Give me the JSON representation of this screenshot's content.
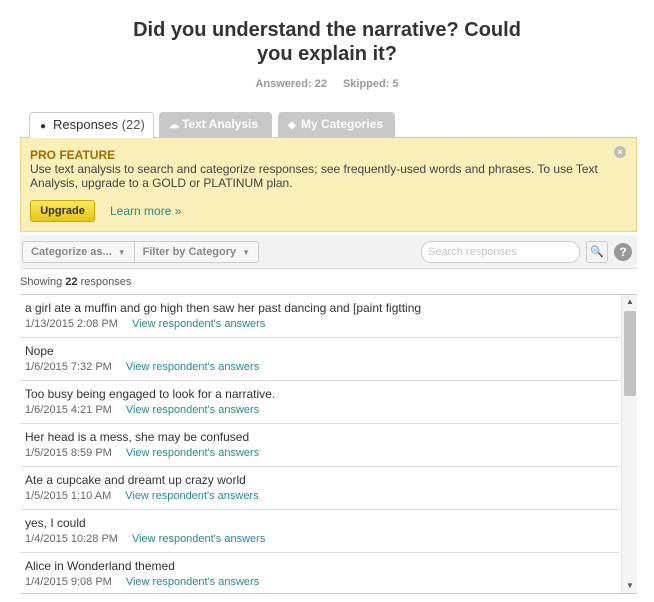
{
  "question": {
    "title_line1": "Did you understand the narrative? Could",
    "title_line2": "you explain it?"
  },
  "stats": {
    "answered": "Answered: 22",
    "skipped": "Skipped: 5"
  },
  "tabs": [
    {
      "label": "Responses",
      "count": "(22)",
      "icon": "speech-bubble-icon",
      "active": true
    },
    {
      "label": "Text Analysis",
      "icon": "cloud-icon",
      "active": false
    },
    {
      "label": "My Categories",
      "icon": "tag-icon",
      "active": false
    }
  ],
  "pro_feature": {
    "title": "PRO FEATURE",
    "text": "Use text analysis to search and categorize responses; see frequently-used words and phrases. To use Text Analysis, upgrade to a GOLD or PLATINUM plan.",
    "upgrade_label": "Upgrade",
    "learn_more_label": "Learn more »"
  },
  "toolbar": {
    "categorize_label": "Categorize as...",
    "filter_label": "Filter by Category",
    "search_placeholder": "Search responses",
    "search_icon": "🔍",
    "help_icon": "?"
  },
  "showing": {
    "prefix": "Showing",
    "count": "22",
    "suffix": "responses"
  },
  "responses": [
    {
      "text": "a girl ate a muffin and go high then saw her past dancing and [paint figtting",
      "timestamp": "1/13/2015 2:08 PM",
      "link": "View respondent's answers"
    },
    {
      "text": "Nope",
      "timestamp": "1/6/2015 7:32 PM",
      "link": "View respondent's answers"
    },
    {
      "text": "Too busy being engaged to look for a narrative.",
      "timestamp": "1/6/2015 4:21 PM",
      "link": "View respondent's answers"
    },
    {
      "text": "Her head is a mess, she may be confused",
      "timestamp": "1/5/2015 8:59 PM",
      "link": "View respondent's answers"
    },
    {
      "text": "Ate a cupcake and dreamt up crazy world",
      "timestamp": "1/5/2015 1:10 AM",
      "link": "View respondent's answers"
    },
    {
      "text": "yes, I could",
      "timestamp": "1/4/2015 10:28 PM",
      "link": "View respondent's answers"
    },
    {
      "text": "Alice in Wonderland themed",
      "timestamp": "1/4/2015 9:08 PM",
      "link": "View respondent's answers"
    }
  ]
}
